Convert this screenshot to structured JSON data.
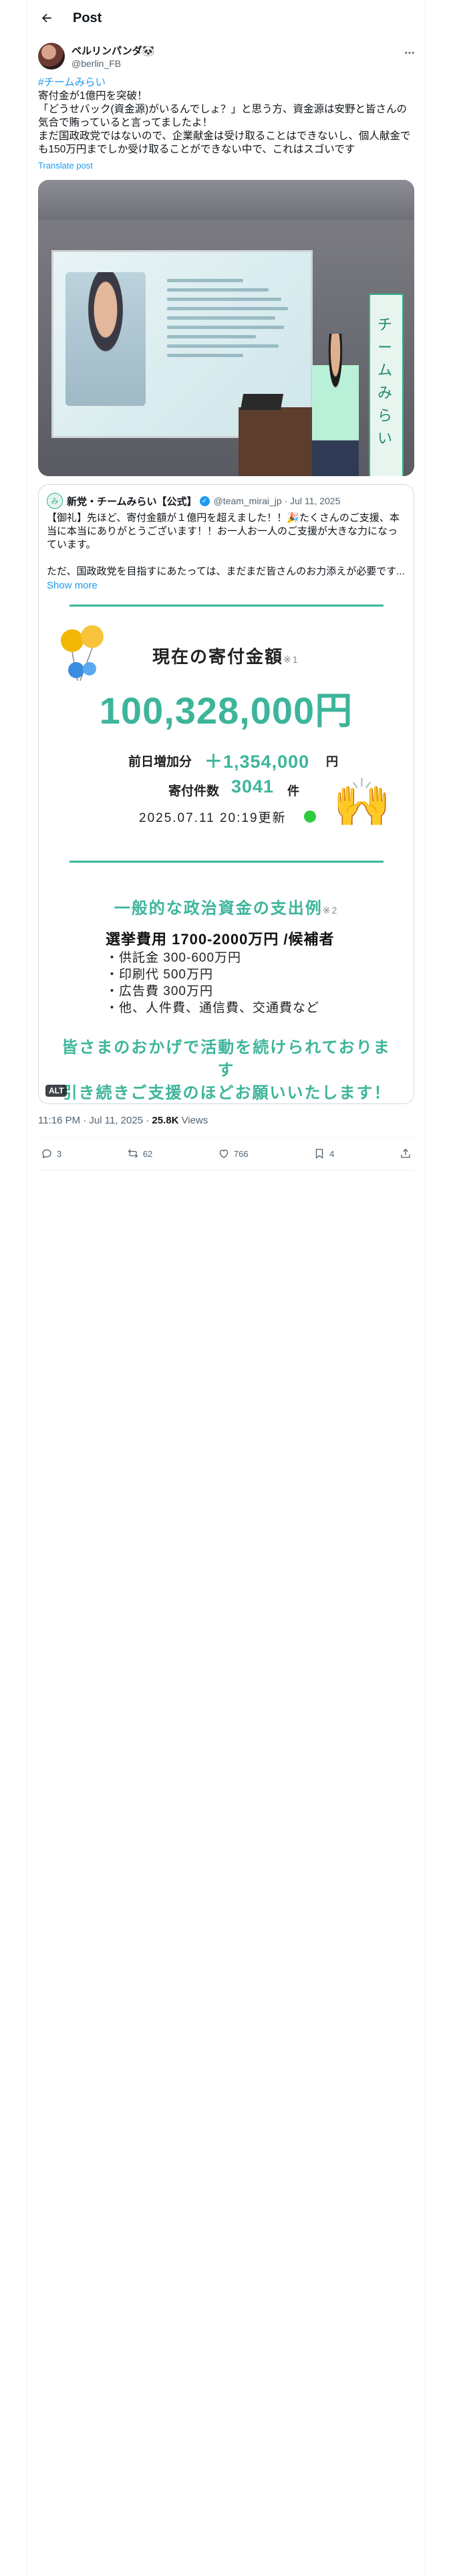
{
  "header": {
    "title": "Post"
  },
  "author": {
    "display_name": "ベルリンパンダ🐼",
    "handle": "@berlin_FB"
  },
  "tweet": {
    "hashtag": "#チームみらい",
    "lines": [
      "寄付金が1億円を突破！",
      "「どうせバック(資金源)がいるんでしょ？」と思う方、資金源は安野と皆さんの気合で賄っていると言ってましたよ！",
      "まだ国政政党ではないので、企業献金は受け取ることはできないし、個人献金でも150万円までしか受け取ることができない中で、これはスゴいです"
    ],
    "translate": "Translate post"
  },
  "photo": {
    "banner_text": "チームみらい"
  },
  "quote": {
    "avatar_text": "み",
    "name": "新党・チームみらい【公式】",
    "handle_date": "@team_mirai_jp · Jul 11, 2025",
    "paragraphs": [
      "【御礼】先ほど、寄付金額が１億円を超えました！！🎉たくさんのご支援、本当に本当にありがとうございます！！お一人お一人のご支援が大きな力になっています。",
      "ただ、国政政党を目指すにあたっては、まだまだ皆さんのお力添えが必要です..."
    ],
    "show_more": "Show more"
  },
  "infographic": {
    "title": "現在の寄付金額",
    "title_note": "※1",
    "amount": "100,328,000円",
    "daily_label": "前日増加分",
    "daily_value": "＋1,354,000",
    "daily_unit": "円",
    "count_label": "寄付件数",
    "count_value": "3041",
    "count_unit": "件",
    "updated": "2025.07.11 20:19更新",
    "exp_title": "一般的な政治資金の支出例",
    "exp_note": "※2",
    "exp_head": "選挙費用 1700-2000万円 /候補者",
    "exp_items": [
      "供託金 300-600万円",
      "印刷代 500万円",
      "広告費 300万円",
      "他、人件費、通信費、交通費など"
    ],
    "thanks_line1": "皆さまのおかげで活動を続けられておりま",
    "thanks_line2": "す",
    "thanks_line3": "引き続きご支援のほどお願いいたします！",
    "alt": "ALT"
  },
  "meta": {
    "time": "11:16 PM · Jul 11, 2025 · ",
    "views_count": "25.8K",
    "views_label": " Views"
  },
  "actions": {
    "replies": "3",
    "reposts": "62",
    "likes": "766",
    "bookmarks": "4"
  },
  "colors": {
    "accent": "#1d9bf0",
    "brand_green": "#3db59a",
    "text": "#0f1419",
    "muted": "#536471"
  }
}
